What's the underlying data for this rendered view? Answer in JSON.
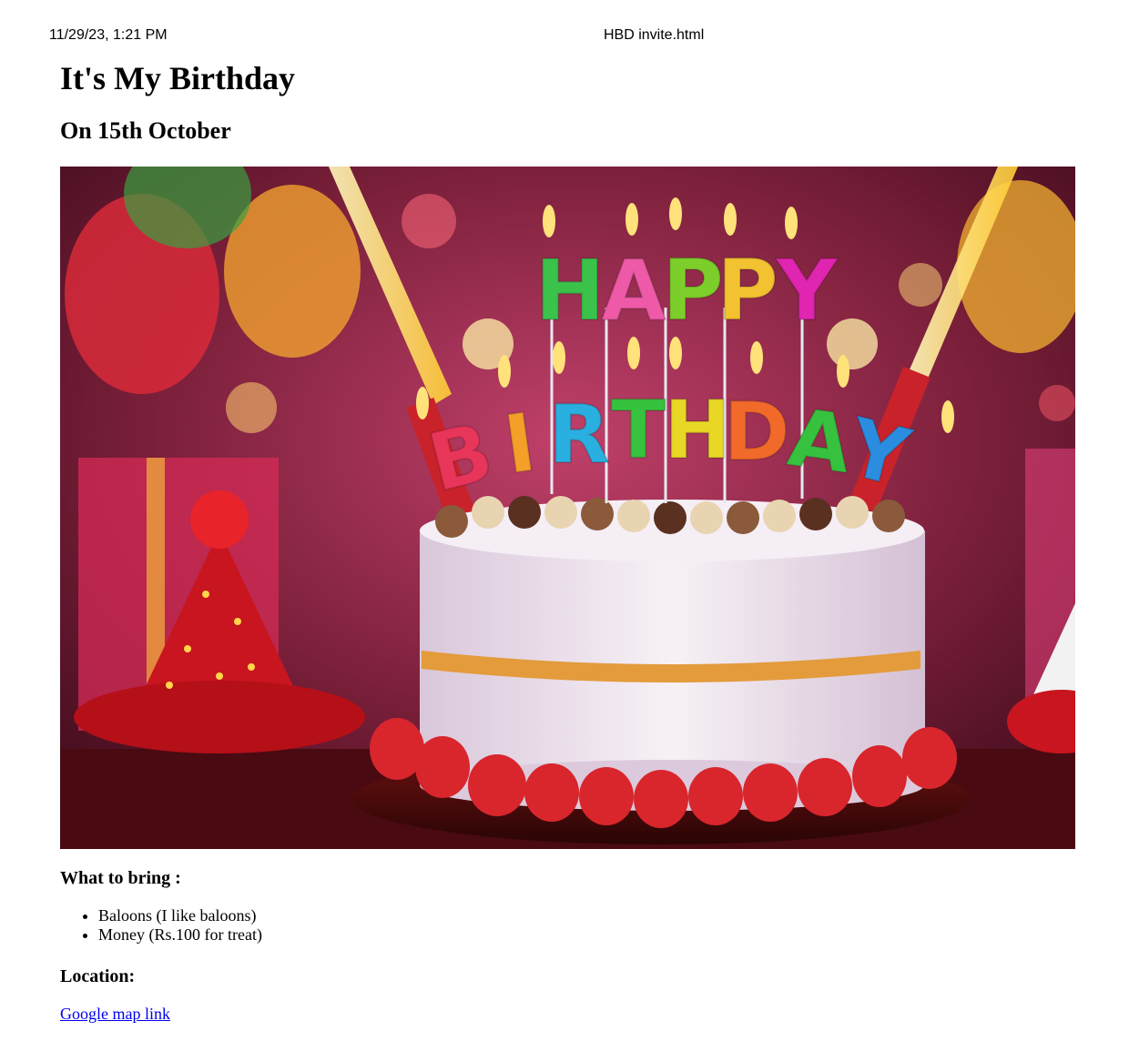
{
  "print_header": {
    "datetime": "11/29/23, 1:21 PM",
    "page_title": "HBD invite.html"
  },
  "heading": "It's My Birthday",
  "subheading": "On 15th October",
  "hero_image": {
    "candle_letters_top": [
      "H",
      "A",
      "P",
      "P",
      "Y"
    ],
    "candle_letters_bottom": [
      "B",
      "I",
      "R",
      "T",
      "H",
      "D",
      "A",
      "Y"
    ],
    "colors": {
      "background": "#7a1f3a",
      "frosting": "#f1e8f0",
      "cream_filling": "#e39b3c",
      "strawberry": "#d8262c",
      "hat": "#c8151f"
    }
  },
  "bring": {
    "heading": "What to bring :",
    "items": [
      "Baloons (I like baloons)",
      "Money (Rs.100 for treat)"
    ]
  },
  "location": {
    "heading": "Location:",
    "link_text": "Google map link"
  }
}
